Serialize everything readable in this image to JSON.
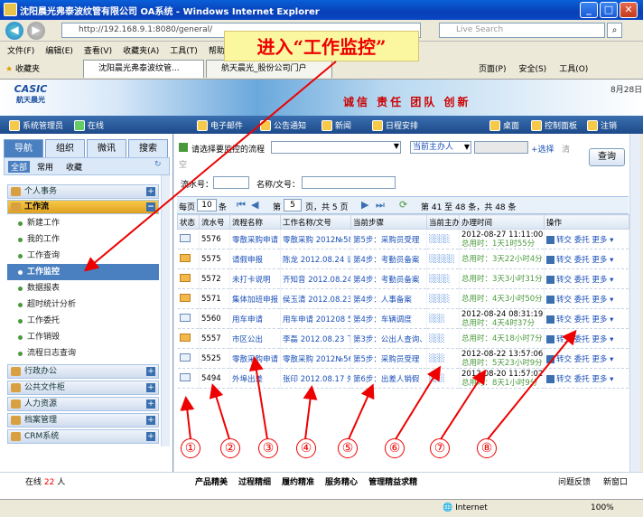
{
  "window": {
    "title": "沈阳晨光弗泰波纹管有限公司 OA系统 - Windows Internet Explorer",
    "min": "_",
    "max": "□",
    "close": "✕"
  },
  "address": {
    "url": "http://192.168.9.1:8080/general/",
    "search_placeholder": "Live Search"
  },
  "menu": [
    "文件(F)",
    "编辑(E)",
    "查看(V)",
    "收藏夹(A)",
    "工具(T)",
    "帮助(H)"
  ],
  "fav": {
    "label": "收藏夹",
    "tabs": [
      "沈阳晨光弗泰波纹管...",
      "航天晨光_股份公司门户"
    ],
    "right": [
      "页面(P)",
      "安全(S)",
      "工具(O)"
    ]
  },
  "callout": "进入“工作监控”",
  "banner": {
    "logo": "航天晨光",
    "logo_sub": "CASIC",
    "slogan": "诚信 责任 团队 创新",
    "date": "8月28日"
  },
  "toolbar": {
    "user": "系统管理员",
    "online": "在线",
    "items": [
      "电子邮件",
      "公告通知",
      "新闻",
      "日程安排"
    ],
    "right": [
      "桌面",
      "控制面板",
      "注销"
    ]
  },
  "left": {
    "tabs": [
      "导航",
      "组织",
      "微讯",
      "搜索"
    ],
    "subtabs": [
      "全部",
      "常用",
      "收藏"
    ],
    "groups_top": [
      "个人事务"
    ],
    "open_group": "工作流",
    "items": [
      "新建工作",
      "我的工作",
      "工作查询",
      "工作监控",
      "数据报表",
      "超时统计分析",
      "工作委托",
      "工作销毁",
      "流程日志查询"
    ],
    "groups_bottom": [
      "行政办公",
      "公共文件柜",
      "人力资源",
      "档案管理",
      "CRM系统"
    ]
  },
  "filter": {
    "flow_label": "请选择要监控的流程",
    "host_select": "当前主办人",
    "select_link": "+选择",
    "clear_link": "清",
    "empty_label": "空",
    "serial_label": "流水号：",
    "name_label": "名称/文号：",
    "query": "查询"
  },
  "pager": {
    "per_page_label": "每页",
    "per_page": "10",
    "unit": "条",
    "page_prefix": "第",
    "page": "5",
    "page_suffix": "页，共 5 页",
    "range": "第 41 至 48 条，共 48 条"
  },
  "table": {
    "headers": [
      "状态",
      "流水号",
      "流程名称",
      "工作名称/文号",
      "当前步骤",
      "当前主办人",
      "办理时间",
      "操作"
    ],
    "rows": [
      {
        "state": "open",
        "id": "5576",
        "flow": "零散采购申请",
        "name": "零散采购 2012№584",
        "step": "第5步：采购员受理",
        "host": "░░░░",
        "time1": "2012-08-27 11:11:00",
        "time2": "总用时：1天1时55分",
        "ops": "转交 委托 更多"
      },
      {
        "state": "closed",
        "id": "5575",
        "flow": "请假申报",
        "name": "陈龙 2012.08.24 请",
        "step": "第4步：考勤员备案",
        "host": "░░░░░",
        "time1": "",
        "time2": "总用时：3天22小时4分",
        "ops": "转交 委托 更多"
      },
      {
        "state": "closed",
        "id": "5572",
        "flow": "未打卡说明",
        "name": "齐知音 2012.08.24",
        "step": "第4步：考勤员备案",
        "host": "░░░░",
        "time1": "",
        "time2": "总用时：3天3小时31分",
        "ops": "转交 委托 更多"
      },
      {
        "state": "closed",
        "id": "5571",
        "flow": "集体加班申报",
        "name": "侯玉清 2012.08.23",
        "step": "第4步：人事备案",
        "host": "░░░░",
        "time1": "",
        "time2": "总用时：4天3小时50分",
        "ops": "转交 委托 更多"
      },
      {
        "state": "open",
        "id": "5560",
        "flow": "用车申请",
        "name": "用车申请 201208 5",
        "step": "第4步：车辆调度",
        "host": "░░░",
        "time1": "2012-08-24 08:31:19",
        "time2": "总用时：4天4时37分",
        "ops": "转交 委托 更多"
      },
      {
        "state": "closed",
        "id": "5557",
        "flow": "市区公出",
        "name": "李磊 2012.08.23 下",
        "step": "第3步：公出人查询、",
        "host": "░░░",
        "time1": "",
        "time2": "总用时：4天18小时7分",
        "ops": "转交 委托 更多"
      },
      {
        "state": "open",
        "id": "5525",
        "flow": "零散采购申请",
        "name": "零散采购 2012№566",
        "step": "第5步：采购员受理",
        "host": "░░░",
        "time1": "2012-08-22 13:57:06",
        "time2": "总用时：5天23小时9分",
        "ops": "转交 委托 更多"
      },
      {
        "state": "open",
        "id": "5494",
        "flow": "外埠出差",
        "name": "张印 2012.08.17 外",
        "step": "第6步：出差人销假",
        "host": "░░░",
        "time1": "2012-08-20 11:57:02",
        "time2": "总用时：8天1小时9分",
        "ops": "转交 委托 更多"
      }
    ]
  },
  "annotations": [
    "①",
    "②",
    "③",
    "④",
    "⑤",
    "⑥",
    "⑦",
    "⑧"
  ],
  "status": {
    "online_label": "在线",
    "online_count": "22",
    "unit": "人",
    "slogans": [
      "产品精美",
      "过程精细",
      "履约精准",
      "服务精心",
      "管理精益求精"
    ],
    "right": [
      "问题反馈",
      "新窗口"
    ]
  },
  "ie": {
    "zone": "Internet",
    "zoom": "100%"
  },
  "colors": {
    "accent": "#4a7fc0",
    "annotation": "#e00000"
  }
}
